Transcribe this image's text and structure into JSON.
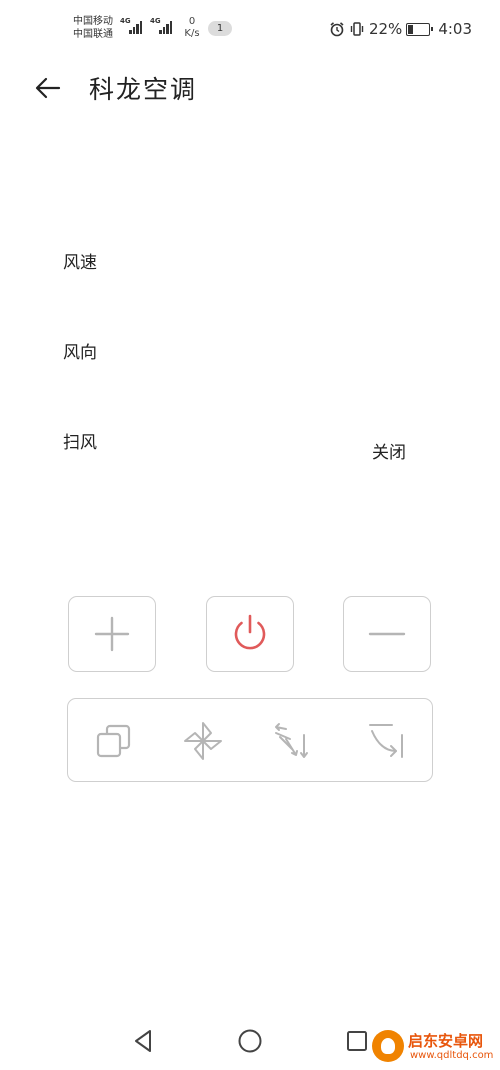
{
  "status_bar": {
    "carrier_1": "中国移动",
    "carrier_2": "中国联通",
    "net_type_1": "4G",
    "net_type_2": "4G",
    "speed_value": "0",
    "speed_unit": "K/s",
    "notification_count": "1",
    "battery_percent": "22%",
    "battery_level": 0.22,
    "time": "4:03"
  },
  "header": {
    "title": "科龙空调"
  },
  "settings": {
    "fan_speed_label": "风速",
    "fan_direction_label": "风向",
    "swing_label": "扫风",
    "swing_value": "关闭"
  },
  "controls": {
    "plus_icon": "plus-icon",
    "power_icon": "power-icon",
    "minus_icon": "minus-icon",
    "power_color": "#e05a5a"
  },
  "modes": [
    "copy-mode-icon",
    "fan-icon",
    "swing-arrows-icon",
    "rotate-icon"
  ],
  "nav": [
    "back-triangle-icon",
    "home-circle-icon",
    "recents-square-icon"
  ],
  "watermark": {
    "name": "启东安卓网",
    "url": "www.qdltdq.com"
  }
}
